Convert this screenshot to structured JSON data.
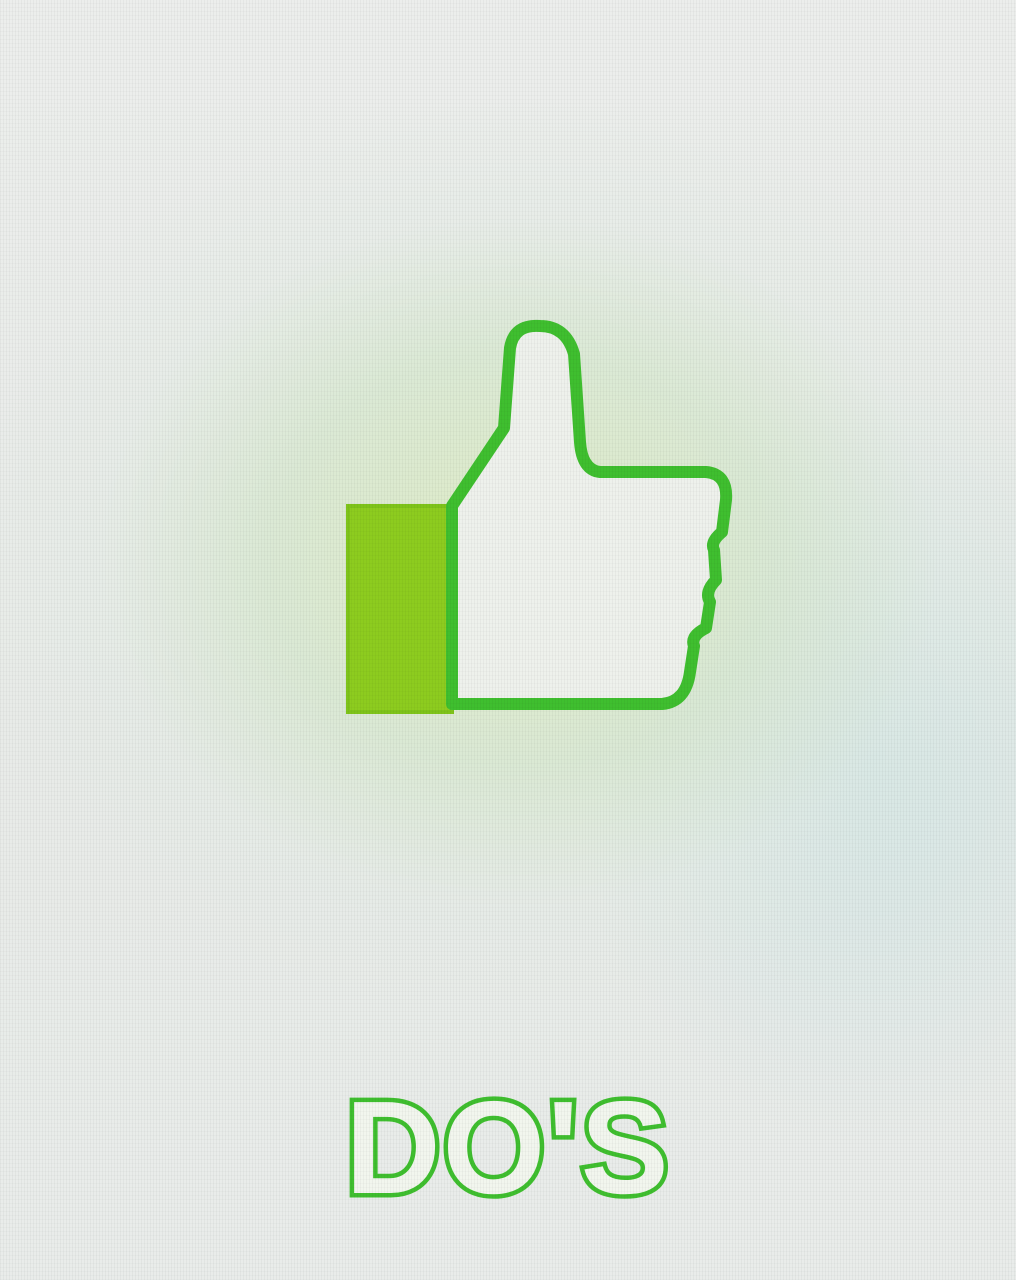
{
  "card": {
    "icon": "thumbs-up-icon",
    "label": "DO'S"
  },
  "colors": {
    "accent": "#3fbf2f",
    "cuff": "#8dcc1f",
    "background": "#e9ece9",
    "glow": "#dcebc4"
  }
}
